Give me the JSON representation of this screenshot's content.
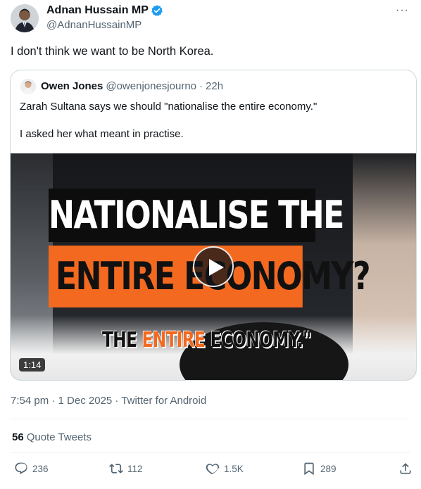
{
  "author": {
    "name": "Adnan Hussain MP",
    "handle": "@AdnanHussainMP",
    "verified_color": "#1d9bf0"
  },
  "more_icon": "more-dots-icon",
  "more_label": "···",
  "tweet": {
    "text": "I don't think we want to be North Korea."
  },
  "quoted": {
    "name": "Owen Jones",
    "handle": "@owenjonesjourno",
    "separator": "·",
    "time": "22h",
    "text_line1": "Zarah Sultana says we should \"nationalise the entire economy.\"",
    "text_line2": "I asked her what meant in practise.",
    "media": {
      "caption_line1": "NATIONALISE THE",
      "caption_line2": "ENTIRE ECONOMY?",
      "subcaption_pre": "THE ",
      "subcaption_accent": "ENTIRE",
      "subcaption_post": " ECONOMY.\"",
      "duration": "1:14",
      "accent_color": "#f3691f"
    }
  },
  "meta": {
    "timestamp": "7:54 pm · 1 Dec 2025 · Twitter for Android"
  },
  "quote_tweets": {
    "count": "56",
    "label": "Quote Tweets"
  },
  "actions": {
    "replies": "236",
    "retweets": "112",
    "likes": "1.5K",
    "bookmarks": "289",
    "accent_color": "#1d9bf0"
  }
}
